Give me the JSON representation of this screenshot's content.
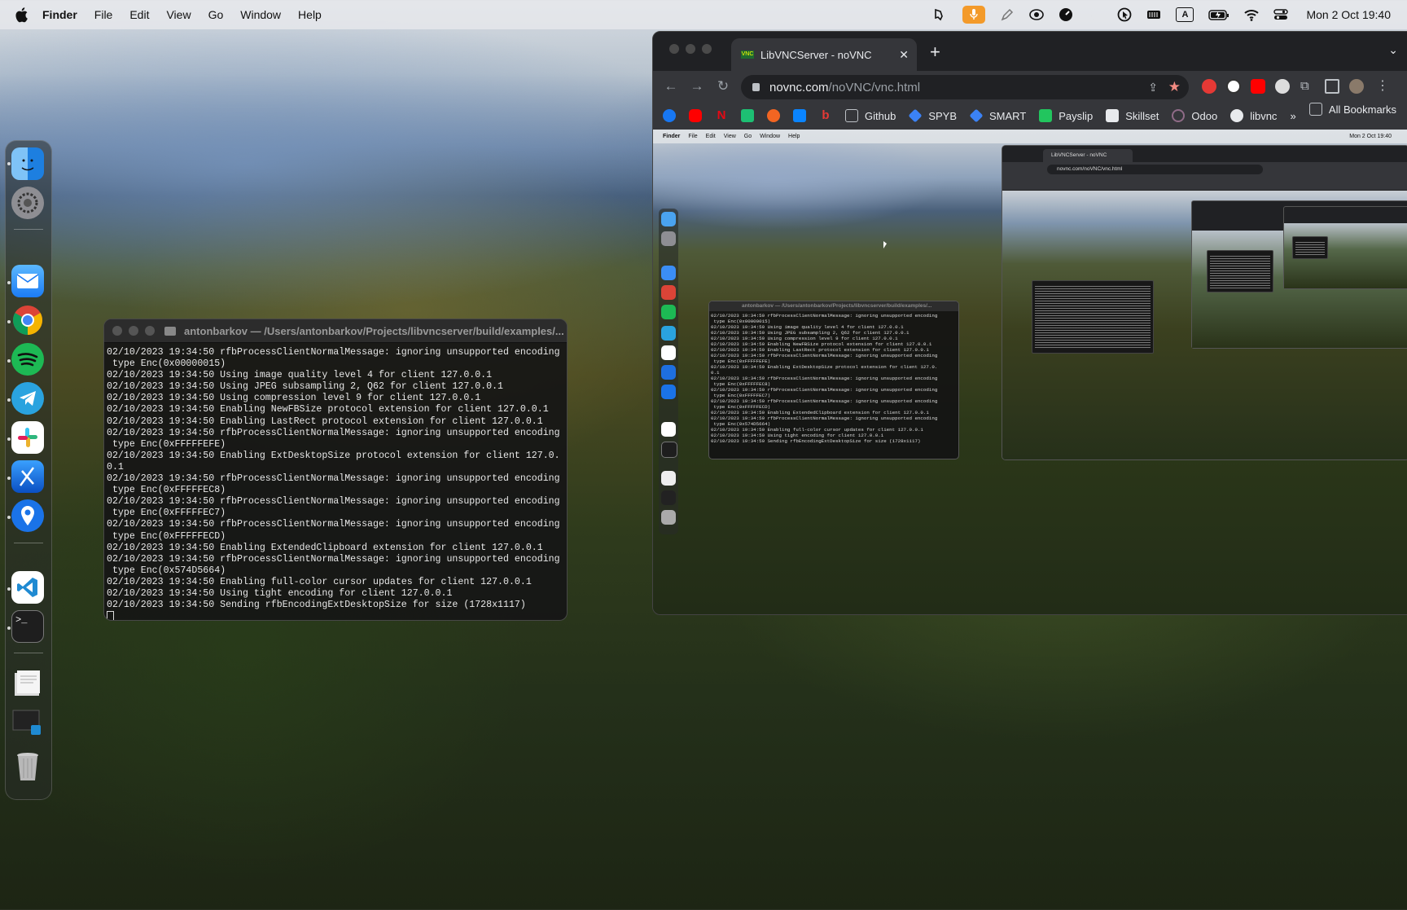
{
  "menubar": {
    "app": "Finder",
    "items": [
      "File",
      "Edit",
      "View",
      "Go",
      "Window",
      "Help"
    ],
    "clock": "Mon 2 Oct  19:40",
    "status_icons": [
      "tool-icon",
      "microphone-icon",
      "pencil-icon",
      "eye-icon",
      "speed-icon",
      "moon-icon",
      "cursor-icon",
      "battery-meter-icon",
      "input-source-icon",
      "battery-icon",
      "wifi-icon",
      "control-center-icon"
    ],
    "input_source": "A"
  },
  "dock": {
    "apps": [
      "finder-icon",
      "system-settings-icon",
      "mail-icon",
      "chrome-icon",
      "spotify-icon",
      "telegram-icon",
      "slack-icon",
      "xcode-icon",
      "maps-pin-icon",
      "vscode-icon",
      "terminal-icon",
      "documents-stack-icon",
      "downloads-stack-icon",
      "trash-icon"
    ],
    "terminal_prompt": ">_"
  },
  "terminal": {
    "title": "antonbarkov — /Users/antonbarkov/Projects/libvncserver/build/examples/...",
    "lines": [
      "02/10/2023 19:34:50 rfbProcessClientNormalMessage: ignoring unsupported encoding",
      " type Enc(0x00000015)",
      "02/10/2023 19:34:50 Using image quality level 4 for client 127.0.0.1",
      "02/10/2023 19:34:50 Using JPEG subsampling 2, Q62 for client 127.0.0.1",
      "02/10/2023 19:34:50 Using compression level 9 for client 127.0.0.1",
      "02/10/2023 19:34:50 Enabling NewFBSize protocol extension for client 127.0.0.1",
      "02/10/2023 19:34:50 Enabling LastRect protocol extension for client 127.0.0.1",
      "02/10/2023 19:34:50 rfbProcessClientNormalMessage: ignoring unsupported encoding",
      " type Enc(0xFFFFFEFE)",
      "02/10/2023 19:34:50 Enabling ExtDesktopSize protocol extension for client 127.0.",
      "0.1",
      "02/10/2023 19:34:50 rfbProcessClientNormalMessage: ignoring unsupported encoding",
      " type Enc(0xFFFFFEC8)",
      "02/10/2023 19:34:50 rfbProcessClientNormalMessage: ignoring unsupported encoding",
      " type Enc(0xFFFFFEC7)",
      "02/10/2023 19:34:50 rfbProcessClientNormalMessage: ignoring unsupported encoding",
      " type Enc(0xFFFFFECD)",
      "02/10/2023 19:34:50 Enabling ExtendedClipboard extension for client 127.0.0.1",
      "02/10/2023 19:34:50 rfbProcessClientNormalMessage: ignoring unsupported encoding",
      " type Enc(0x574D5664)",
      "02/10/2023 19:34:50 Enabling full-color cursor updates for client 127.0.0.1",
      "02/10/2023 19:34:50 Using tight encoding for client 127.0.0.1",
      "02/10/2023 19:34:50 Sending rfbEncodingExtDesktopSize for size (1728x1117)"
    ]
  },
  "browser": {
    "tab_title": "LibVNCServer - noVNC",
    "tab_favicon_text": "VNC",
    "url_host": "novnc.com",
    "url_path": "/noVNC/vnc.html",
    "bookmarks": [
      {
        "label": "",
        "icon": "facebook-icon",
        "color": "#1877f2"
      },
      {
        "label": "",
        "icon": "youtube-icon",
        "color": "#ff0000"
      },
      {
        "label": "",
        "icon": "netflix-icon",
        "color": "#e50914"
      },
      {
        "label": "",
        "icon": "mail-icon",
        "color": "#1dbf73"
      },
      {
        "label": "",
        "icon": "orange-circle-icon",
        "color": "#f26522"
      },
      {
        "label": "",
        "icon": "outlook-icon",
        "color": "#0a84ff"
      },
      {
        "label": "",
        "icon": "b-icon",
        "color": "#e53935"
      },
      {
        "label": "Github",
        "icon": "folder-icon",
        "color": "#9aa0a6"
      },
      {
        "label": "SPYB",
        "icon": "diamond-icon",
        "color": "#3b82f6"
      },
      {
        "label": "SMART",
        "icon": "diamond-icon",
        "color": "#3b82f6"
      },
      {
        "label": "Payslip",
        "icon": "plus-icon",
        "color": "#22c55e"
      },
      {
        "label": "Skillset",
        "icon": "skillset-icon",
        "color": "#e8eaed"
      },
      {
        "label": "Odoo",
        "icon": "odoo-icon",
        "color": "#8f6b87"
      },
      {
        "label": "libvnc",
        "icon": "github-icon",
        "color": "#e8eaed"
      }
    ],
    "more_label": "»",
    "all_bookmarks_label": "All Bookmarks",
    "mini_menu": [
      "Finder",
      "File",
      "Edit",
      "View",
      "Go",
      "Window",
      "Help"
    ],
    "mini_clock": "Mon 2 Oct 19:40",
    "mini_terminal_title": "antonbarkov — /Users/antonbarkov/Projects/libvncserver/build/examples/...",
    "mini_tab_title": "LibVNCServer - noVNC",
    "mini_url": "novnc.com/noVNC/vnc.html"
  }
}
